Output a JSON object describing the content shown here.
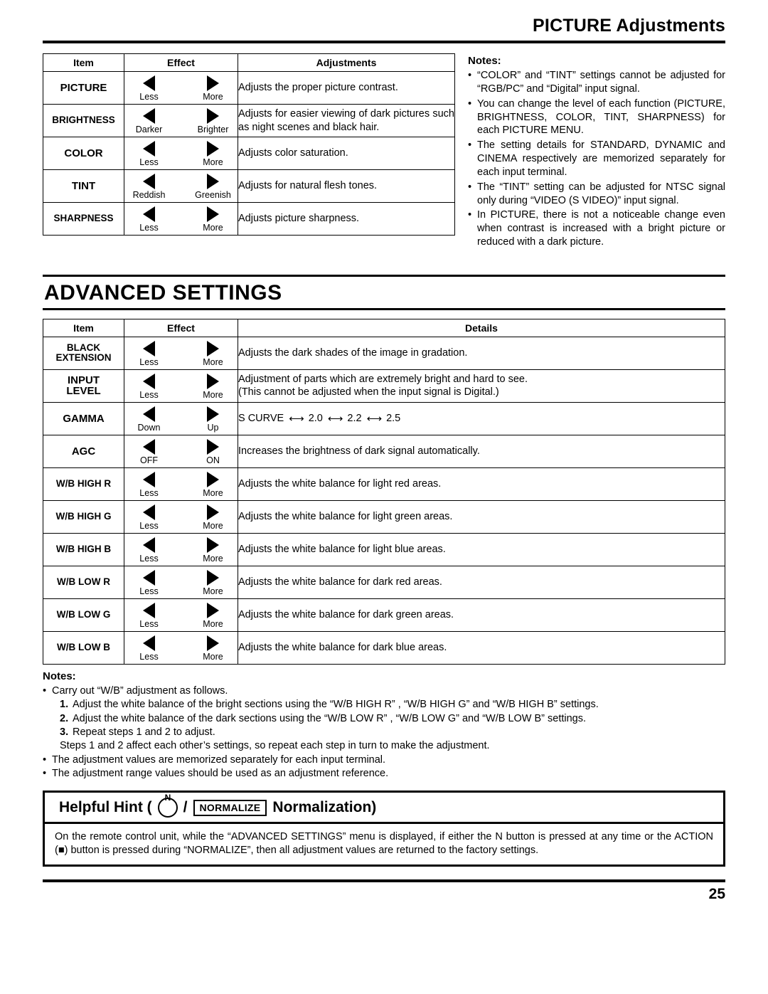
{
  "header": {
    "title": "PICTURE Adjustments"
  },
  "picture_table": {
    "columns": [
      "Item",
      "Effect",
      "Adjustments"
    ],
    "rows": [
      {
        "item": "PICTURE",
        "left_label": "Less",
        "right_label": "More",
        "desc": "Adjusts the proper picture contrast."
      },
      {
        "item": "BRIGHTNESS",
        "left_label": "Darker",
        "right_label": "Brighter",
        "desc": "Adjusts for easier viewing of dark pictures such as night scenes and black hair."
      },
      {
        "item": "COLOR",
        "left_label": "Less",
        "right_label": "More",
        "desc": "Adjusts color saturation."
      },
      {
        "item": "TINT",
        "left_label": "Reddish",
        "right_label": "Greenish",
        "desc": "Adjusts for natural flesh tones."
      },
      {
        "item": "SHARPNESS",
        "left_label": "Less",
        "right_label": "More",
        "desc": "Adjusts picture sharpness."
      }
    ]
  },
  "picture_notes": {
    "title": "Notes:",
    "items": [
      "“COLOR” and “TINT” settings cannot be adjusted for “RGB/PC” and “Digital” input signal.",
      "You can change the level of each function (PICTURE, BRIGHTNESS, COLOR, TINT, SHARPNESS) for each PICTURE MENU.",
      "The setting details for STANDARD, DYNAMIC and CINEMA respectively are memorized separately for each input terminal.",
      "The “TINT” setting can be adjusted for NTSC signal only during “VIDEO (S VIDEO)” input signal.",
      "In PICTURE, there is not a noticeable change even when contrast is increased with a bright picture or reduced with a dark picture."
    ]
  },
  "advanced": {
    "title": "ADVANCED SETTINGS",
    "columns": [
      "Item",
      "Effect",
      "Details"
    ],
    "rows": [
      {
        "item": "BLACK EXTENSION",
        "left_label": "Less",
        "right_label": "More",
        "details": "Adjusts the dark shades of the image in gradation."
      },
      {
        "item": "INPUT LEVEL",
        "left_label": "Less",
        "right_label": "More",
        "details": "Adjustment of parts which are extremely bright and hard to see.\n(This cannot be adjusted when the input signal is Digital.)"
      },
      {
        "item": "GAMMA",
        "left_label": "Down",
        "right_label": "Up",
        "details_gamma": [
          "S CURVE",
          "2.0",
          "2.2",
          "2.5"
        ]
      },
      {
        "item": "AGC",
        "left_label": "OFF",
        "right_label": "ON",
        "details": "Increases the brightness of dark signal automatically."
      },
      {
        "item": "W/B HIGH R",
        "left_label": "Less",
        "right_label": "More",
        "details": "Adjusts the white balance for light red areas."
      },
      {
        "item": "W/B HIGH G",
        "left_label": "Less",
        "right_label": "More",
        "details": "Adjusts the white balance for light green areas."
      },
      {
        "item": "W/B HIGH B",
        "left_label": "Less",
        "right_label": "More",
        "details": "Adjusts the white balance for light blue areas."
      },
      {
        "item": "W/B LOW R",
        "left_label": "Less",
        "right_label": "More",
        "details": "Adjusts the white balance for dark red areas."
      },
      {
        "item": "W/B LOW G",
        "left_label": "Less",
        "right_label": "More",
        "details": "Adjusts the white balance for dark green areas."
      },
      {
        "item": "W/B LOW B",
        "left_label": "Less",
        "right_label": "More",
        "details": "Adjusts the white balance for dark blue areas."
      }
    ]
  },
  "advanced_notes": {
    "title": "Notes:",
    "lead": "Carry out “W/B” adjustment as follows.",
    "steps": [
      {
        "n": "1.",
        "text": "Adjust the white balance of the bright sections using the “W/B HIGH R” , “W/B HIGH G” and “W/B HIGH B” settings."
      },
      {
        "n": "2.",
        "text": "Adjust the white balance of the dark sections using the “W/B LOW R” , “W/B LOW G” and “W/B LOW B” settings."
      },
      {
        "n": "3.",
        "text": "Repeat steps 1 and 2 to adjust."
      }
    ],
    "steps_note": "Steps 1 and 2 affect each other’s settings, so repeat each step in turn to make the adjustment.",
    "tail": [
      "The adjustment values are memorized separately for each input terminal.",
      "The adjustment range values should be used as an adjustment reference."
    ]
  },
  "hint": {
    "title_prefix": "Helpful Hint (",
    "n_sup": "N",
    "slash": "/",
    "chip": "NORMALIZE",
    "title_suffix": "Normalization)",
    "body": "On the remote control unit, while the “ADVANCED SETTINGS” menu is displayed, if either the N button is pressed at any time or the ACTION (■) button is pressed during “NORMALIZE”, then all adjustment values are returned to the factory settings."
  },
  "footer": {
    "page_number": "25"
  }
}
